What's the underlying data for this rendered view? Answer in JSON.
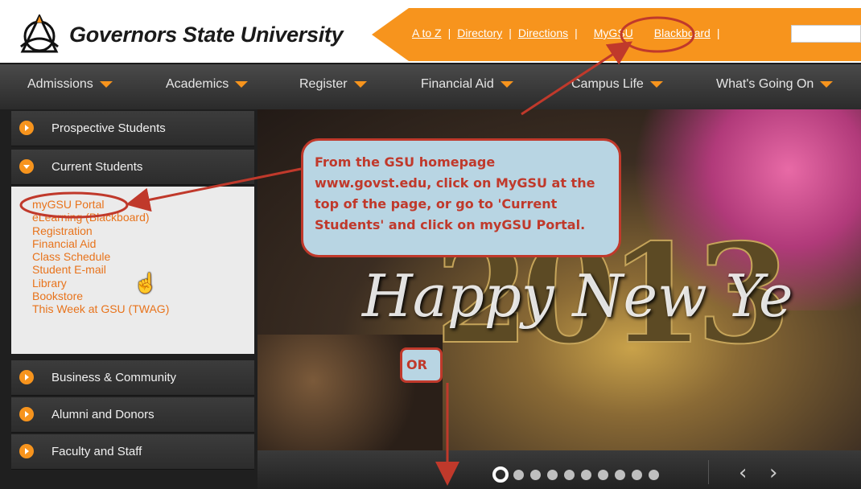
{
  "header": {
    "university_name": "Governors State University",
    "logo_icon": "gsu-logo-icon",
    "quick_links": [
      "A to Z",
      "Directory",
      "Directions",
      "MyGSU",
      "Blackboard"
    ],
    "separator": "|",
    "search_placeholder": ""
  },
  "main_nav": {
    "items": [
      "Admissions",
      "Academics",
      "Register",
      "Financial Aid",
      "Campus Life",
      "What's Going On"
    ]
  },
  "sidebar": {
    "sections": [
      {
        "label": "Prospective Students",
        "icon": "arrow-right-bullet-icon"
      },
      {
        "label": "Current Students",
        "icon": "arrow-down-bullet-icon"
      },
      {
        "label": "Business & Community",
        "icon": "arrow-right-bullet-icon"
      },
      {
        "label": "Alumni and Donors",
        "icon": "arrow-right-bullet-icon"
      },
      {
        "label": "Faculty and Staff",
        "icon": "arrow-right-bullet-icon"
      }
    ],
    "current_students_links": [
      "myGSU Portal",
      "eLearning (Blackboard)",
      "Registration",
      "Financial Aid",
      "Class Schedule",
      "Student E-mail",
      "Library",
      "Bookstore",
      "This Week at GSU (TWAG)"
    ]
  },
  "hero": {
    "greeting": "Happy New Ye",
    "year": "2013"
  },
  "annotations": {
    "callout": "From the GSU homepage www.govst.edu, click on MyGSU at the top of the page, or go to 'Current Students' and click on myGSU Portal.",
    "or_label": "OR"
  },
  "slider": {
    "dot_count": 10,
    "active_index": 0,
    "prev_arrow": "‹",
    "next_arrow": "›"
  },
  "colors": {
    "brand_orange": "#f7941d",
    "nav_dark": "#2b2b2b",
    "link_orange": "#e8731b",
    "annotation_red": "#c0392b",
    "callout_bg": "#b8d5e3"
  }
}
